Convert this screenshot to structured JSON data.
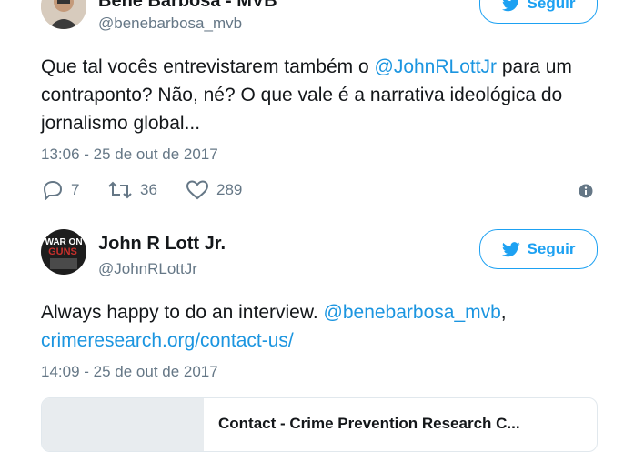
{
  "tweet1": {
    "name": "Bene Barbosa - MVB",
    "handle": "@benebarbosa_mvb",
    "follow_label": "Seguir",
    "text_before": "Que tal vocês entrevistarem também o ",
    "mention": "@JohnRLottJr",
    "text_after": " para um contraponto? Não, né? O que vale é a narrativa ideológica do jornalismo global...",
    "timestamp": "13:06 - 25 de out de 2017",
    "replies": "7",
    "retweets": "36",
    "likes": "289"
  },
  "tweet2": {
    "name": "John R Lott Jr.",
    "handle": "@JohnRLottJr",
    "follow_label": "Seguir",
    "avatar_text": "WAR ON GUNS",
    "text_before": "Always happy to do an interview. ",
    "mention": "@benebarbosa_mvb",
    "text_sep": ",",
    "link": "crimeresearch.org/contact-us/",
    "timestamp": "14:09 - 25 de out de 2017",
    "card_title": "Contact - Crime Prevention Research C..."
  },
  "colors": {
    "accent": "#1da1f2",
    "link": "#1b95e0",
    "secondary": "#657786"
  },
  "icons": [
    "twitter-bird-icon",
    "reply-icon",
    "retweet-icon",
    "heart-icon",
    "info-icon"
  ]
}
